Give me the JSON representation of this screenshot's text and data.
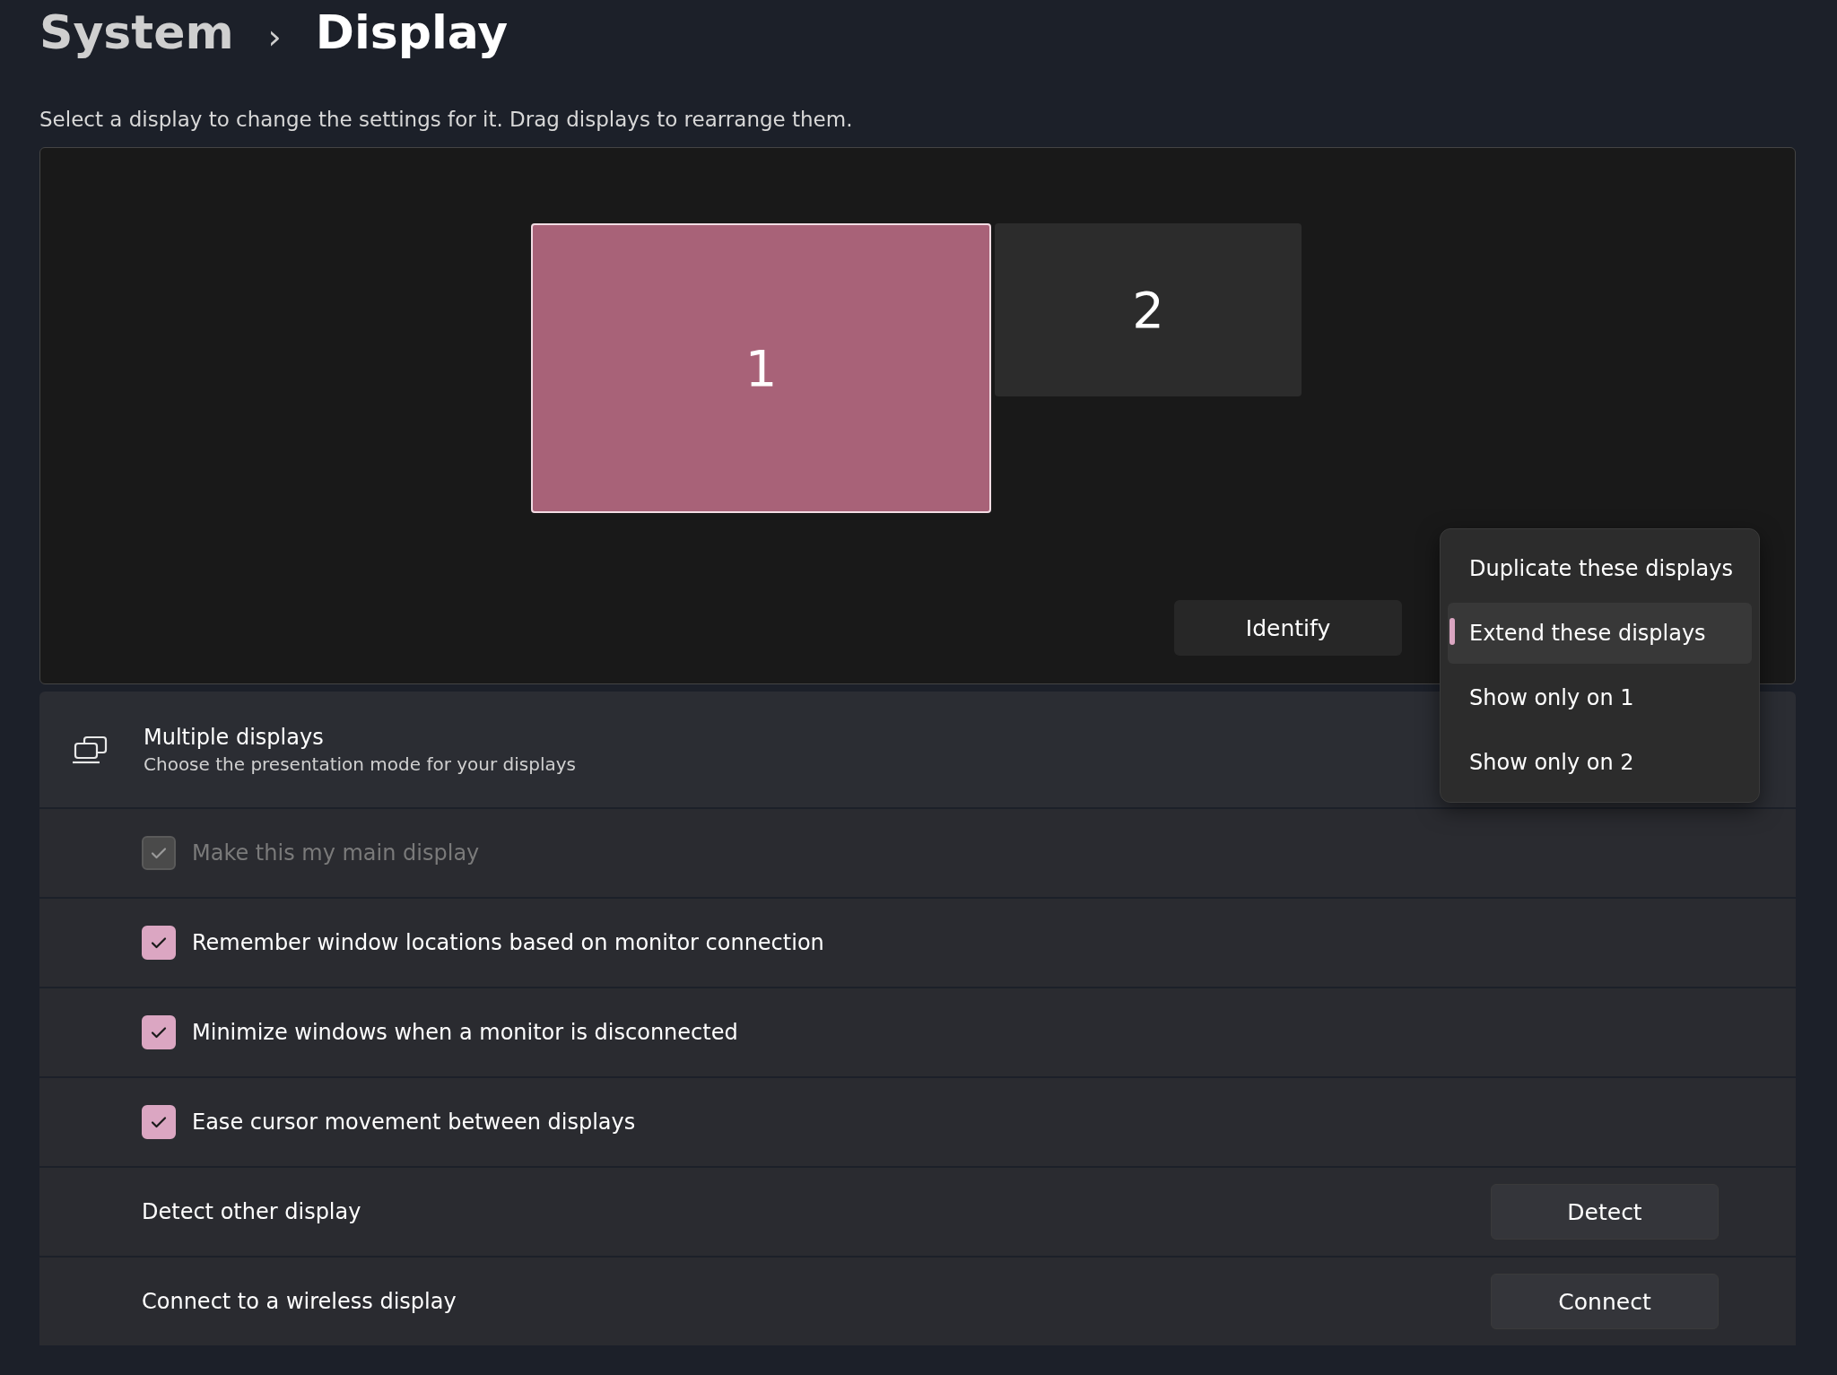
{
  "breadcrumb": {
    "parent": "System",
    "separator": "›",
    "current": "Display"
  },
  "description": "Select a display to change the settings for it. Drag displays to rearrange them.",
  "monitors": [
    {
      "label": "1",
      "selected": true
    },
    {
      "label": "2",
      "selected": false
    }
  ],
  "identify_button": "Identify",
  "presentation_menu": [
    {
      "label": "Duplicate these displays",
      "selected": false
    },
    {
      "label": "Extend these displays",
      "selected": true
    },
    {
      "label": "Show only on 1",
      "selected": false
    },
    {
      "label": "Show only on 2",
      "selected": false
    }
  ],
  "multiple_displays": {
    "title": "Multiple displays",
    "subtitle": "Choose the presentation mode for your displays"
  },
  "settings": [
    {
      "kind": "checkbox",
      "label": "Make this my main display",
      "checked": true,
      "disabled": true
    },
    {
      "kind": "checkbox",
      "label": "Remember window locations based on monitor connection",
      "checked": true,
      "disabled": false
    },
    {
      "kind": "checkbox",
      "label": "Minimize windows when a monitor is disconnected",
      "checked": true,
      "disabled": false
    },
    {
      "kind": "checkbox",
      "label": "Ease cursor movement between displays",
      "checked": true,
      "disabled": false
    },
    {
      "kind": "button",
      "label": "Detect other display",
      "button": "Detect"
    },
    {
      "kind": "button",
      "label": "Connect to a wireless display",
      "button": "Connect"
    }
  ]
}
